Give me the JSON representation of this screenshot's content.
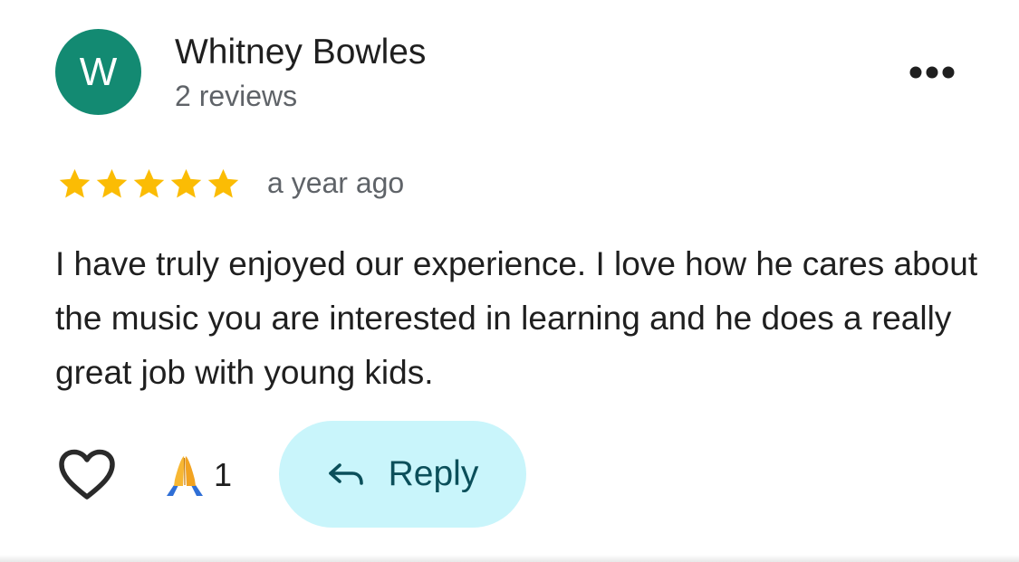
{
  "review": {
    "avatar_letter": "W",
    "avatar_color": "#138a72",
    "author_name": "Whitney Bowles",
    "author_reviews": "2 reviews",
    "more_icon": "more-horizontal-icon",
    "rating": 5,
    "rating_max": 5,
    "star_color": "#fbbc04",
    "time_ago": "a year ago",
    "text": "I have truly enjoyed our experience.  I love how he cares about the music you are interested in learning and he does a really great job with young kids."
  },
  "actions": {
    "like_icon": "heart-outline-icon",
    "reaction_icon": "folded-hands-emoji-icon",
    "reaction_count": "1",
    "reply_icon": "reply-arrow-icon",
    "reply_label": "Reply",
    "reply_bg_color": "#c9f5fb"
  }
}
